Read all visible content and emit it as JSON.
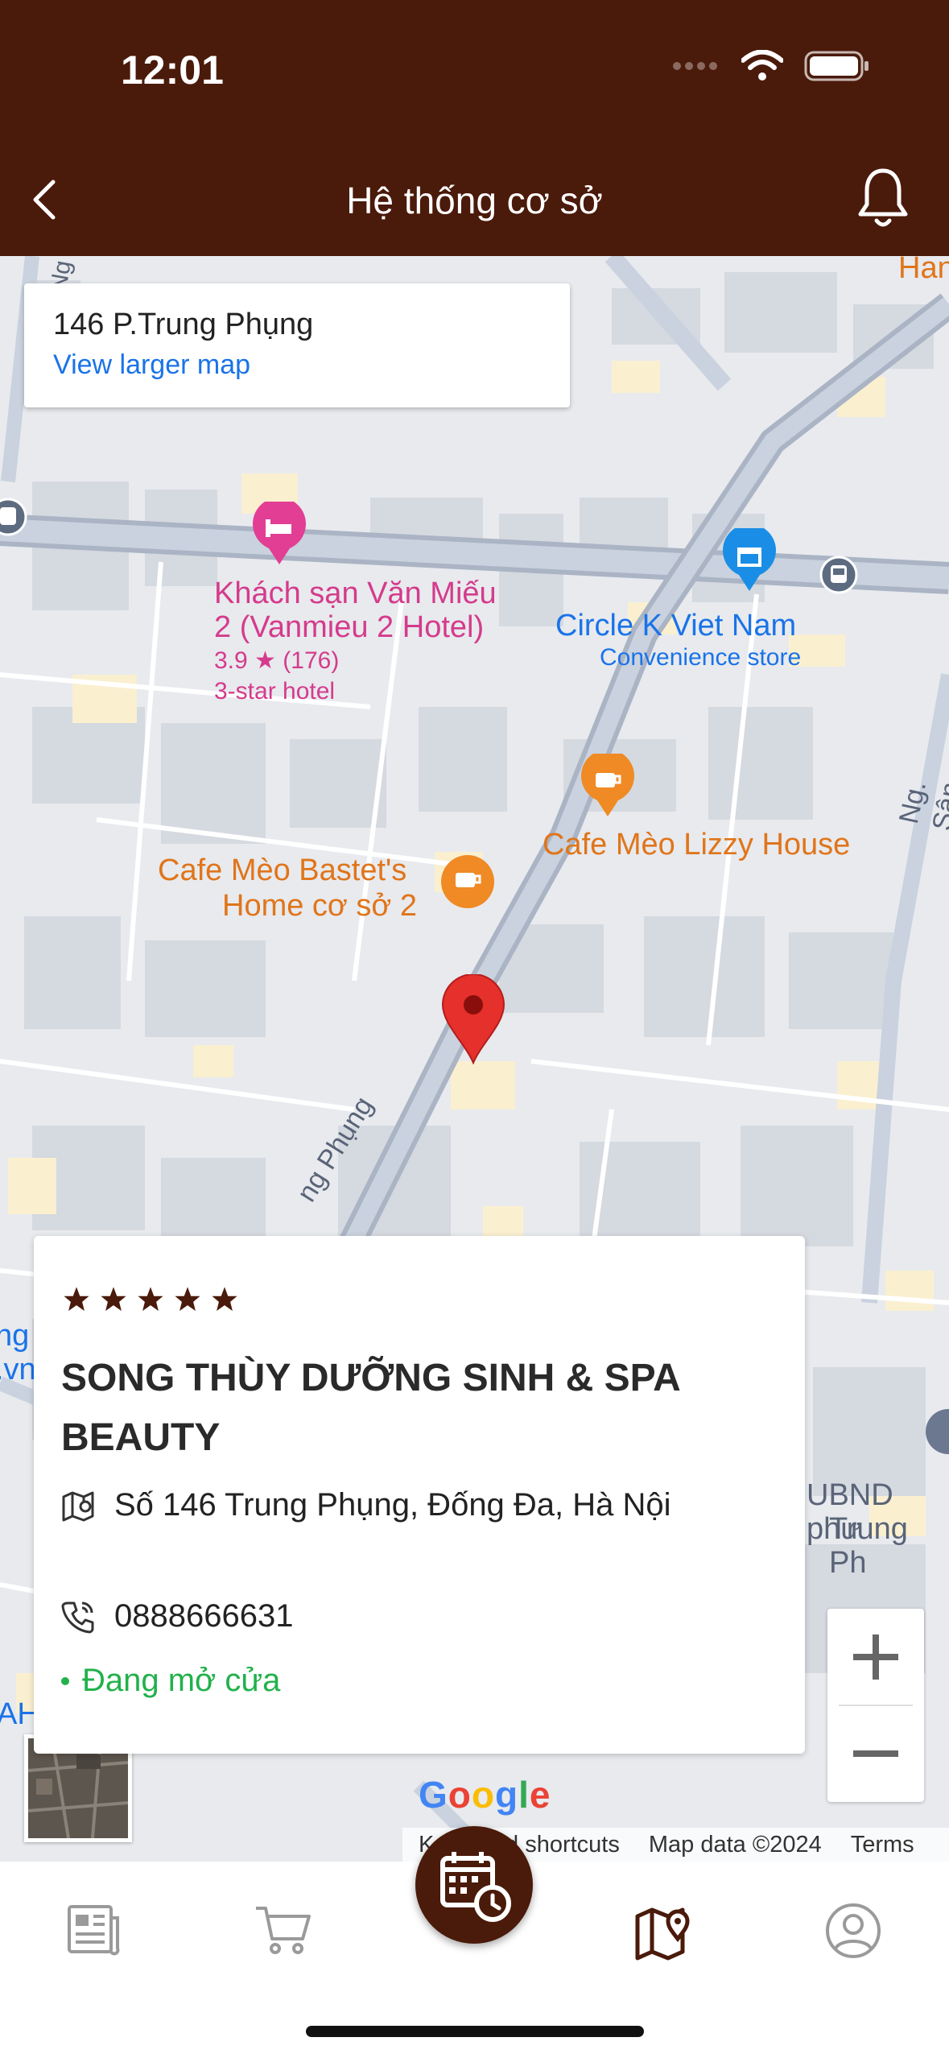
{
  "status_bar": {
    "time": "12:01"
  },
  "header": {
    "title": "Hệ thống cơ sở"
  },
  "map": {
    "card_title": "146 P.Trung Phụng",
    "card_link": "View larger map",
    "labels": {
      "hotel_name_1": "Khách sạn Văn Miếu",
      "hotel_name_2": "2 (Vanmieu 2 Hotel)",
      "hotel_rating": "3.9 ★ (176)",
      "hotel_type": "3-star hotel",
      "circlek_name": "Circle K Viet Nam",
      "circlek_type": "Convenience store",
      "cafe_lizzy": "Cafe Mèo Lizzy House",
      "cafe_bastet_1": "Cafe Mèo Bastet's",
      "cafe_bastet_2": "Home cơ sở 2",
      "street_trung_phung": "ng Phụng",
      "street_san_quan": "Ng. Sân Quần",
      "ubnd_1": "UBND phư",
      "ubnd_2": "Trung Ph",
      "edge_top_right": "Han",
      "edge_left_1": "ng",
      "edge_left_2": ".vn",
      "edge_left_3": "AH",
      "street_top_left": "Ng"
    },
    "google_logo": "Google",
    "footer": {
      "shortcuts": "Keyboard shortcuts",
      "data": "Map data ©2024",
      "terms": "Terms"
    }
  },
  "info_card": {
    "rating_stars": 5,
    "name": "SONG THÙY DƯỠNG SINH & SPA BEAUTY",
    "address": "Số 146 Trung Phụng, Đống Đa, Hà Nội",
    "phone": "0888666631",
    "status": "Đang mở cửa"
  },
  "zoom": {
    "in": "+",
    "out": "−"
  },
  "bottom_nav": {
    "items": [
      {
        "icon": "news-icon"
      },
      {
        "icon": "cart-icon"
      },
      {
        "icon": "calendar-clock-icon"
      },
      {
        "icon": "map-pin-icon",
        "active": true
      },
      {
        "icon": "profile-icon"
      }
    ]
  },
  "colors": {
    "brand": "#4a1a0a",
    "open": "#22b14c",
    "link": "#1a73e8"
  }
}
